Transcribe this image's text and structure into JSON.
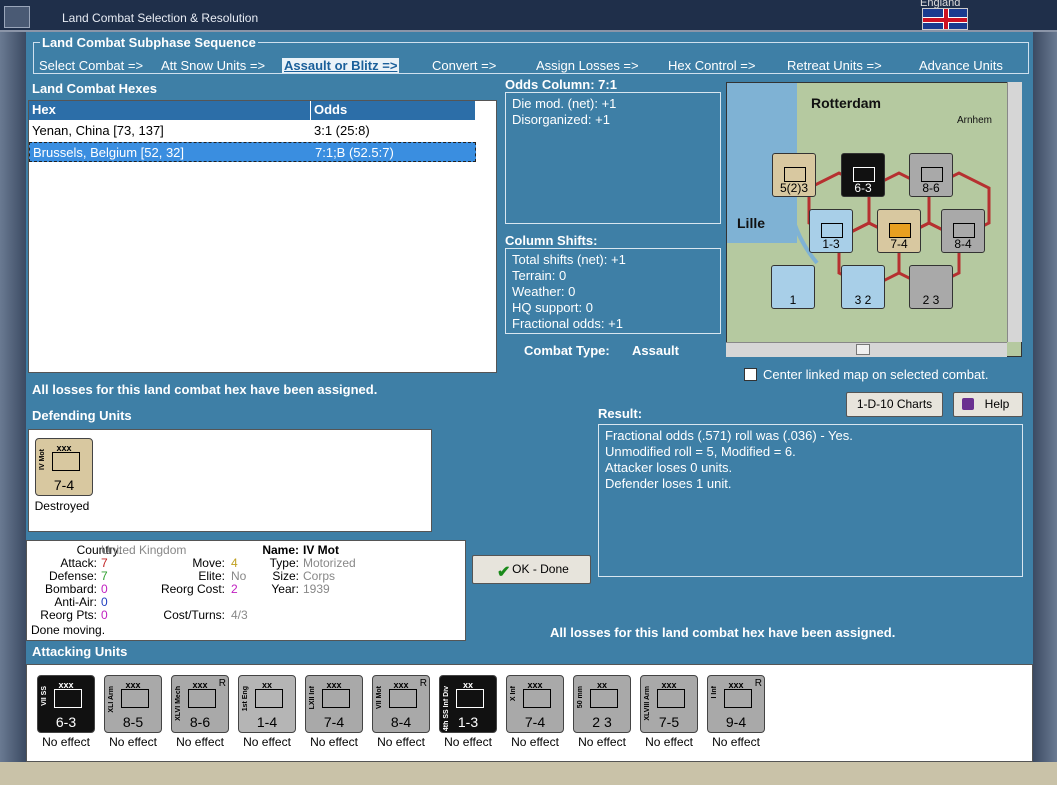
{
  "window": {
    "title": "Land Combat Selection & Resolution",
    "nation": "England"
  },
  "sequence": {
    "title": "Land Combat Subphase Sequence",
    "items": [
      "Select Combat =>",
      "Att Snow Units =>",
      "Assault or Blitz =>",
      "Convert =>",
      "Assign Losses =>",
      "Hex Control =>",
      "Retreat Units =>",
      "Advance Units"
    ],
    "active_index": 2
  },
  "hexes": {
    "title": "Land Combat Hexes",
    "col_hex": "Hex",
    "col_odds": "Odds",
    "rows": [
      {
        "hex": "Yenan, China [73, 137]",
        "odds": "3:1 (25:8)",
        "selected": false
      },
      {
        "hex": "Brussels, Belgium [52, 32]",
        "odds": "7:1;B (52.5:7)",
        "selected": true
      }
    ]
  },
  "odds": {
    "title": "Odds Column: 7:1",
    "lines": [
      "Die mod. (net): +1",
      "Disorganized: +1"
    ]
  },
  "shifts": {
    "title": "Column Shifts:",
    "lines": [
      "Total shifts (net): +1",
      "Terrain: 0",
      "Weather: 0",
      "HQ support: 0",
      "Fractional odds: +1"
    ]
  },
  "combat_type": {
    "label": "Combat Type:",
    "value": "Assault"
  },
  "map": {
    "labels": [
      "Rotterdam",
      "Lille",
      "Arnhem"
    ]
  },
  "losses_msg": "All losses for this land combat hex have been assigned.",
  "center_checkbox": "Center linked map on selected combat.",
  "buttons": {
    "charts": "1-D-10 Charts",
    "help": "Help",
    "ok": "OK - Done"
  },
  "defending": {
    "title": "Defending Units",
    "units": [
      {
        "name": "IV Mot",
        "size": "xxx",
        "strength": "7-4",
        "status": "Destroyed",
        "color": "#d8c8a0"
      }
    ]
  },
  "stats": {
    "country_l": "Country:",
    "country": "United Kingdom",
    "attack_l": "Attack:",
    "attack": "7",
    "defense_l": "Defense:",
    "defense": "7",
    "bombard_l": "Bombard:",
    "bombard": "0",
    "antiair_l": "Anti-Air:",
    "antiair": "0",
    "reorg_l": "Reorg Pts:",
    "reorg": "0",
    "move_l": "Move:",
    "move": "4",
    "elite_l": "Elite:",
    "elite": "No",
    "reorgcost_l": "Reorg Cost:",
    "reorgcost": "2",
    "costturns_l": "Cost/Turns:",
    "costturns": "4/3",
    "name_l": "Name:",
    "name": "IV Mot",
    "type_l": "Type:",
    "type": "Motorized",
    "size_l": "Size:",
    "size": "Corps",
    "year_l": "Year:",
    "year": "1939",
    "done": "Done moving."
  },
  "result": {
    "title": "Result:",
    "lines": [
      "Fractional odds (.571) roll was (.036)  - Yes.",
      "Unmodified roll = 5, Modified = 6.",
      "Attacker loses 0 units.",
      "Defender loses 1 unit."
    ]
  },
  "attacking": {
    "title": "Attacking Units",
    "units": [
      {
        "name": "VII SS",
        "size": "xxx",
        "strength": "6-3",
        "status": "No effect",
        "color": "#111111",
        "fg": "#ffffff",
        "r": ""
      },
      {
        "name": "XLI Arm",
        "size": "xxx",
        "strength": "8-5",
        "status": "No effect",
        "color": "#a9a9a9",
        "fg": "#000000",
        "r": ""
      },
      {
        "name": "XLVI Mech",
        "size": "xxx",
        "strength": "8-6",
        "status": "No effect",
        "color": "#a9a9a9",
        "fg": "#000000",
        "r": "R"
      },
      {
        "name": "1st Eng",
        "size": "xx",
        "strength": "1-4",
        "status": "No effect",
        "color": "#b5b5b5",
        "fg": "#000000",
        "r": ""
      },
      {
        "name": "LXII Inf",
        "size": "xxx",
        "strength": "7-4",
        "status": "No effect",
        "color": "#a9a9a9",
        "fg": "#000000",
        "r": ""
      },
      {
        "name": "VII Mot",
        "size": "xxx",
        "strength": "8-4",
        "status": "No effect",
        "color": "#a9a9a9",
        "fg": "#000000",
        "r": "R"
      },
      {
        "name": "4th SS Inf Div",
        "size": "xx",
        "strength": "1-3",
        "status": "No effect",
        "color": "#111111",
        "fg": "#ffffff",
        "r": ""
      },
      {
        "name": "X Inf",
        "size": "xxx",
        "strength": "7-4",
        "status": "No effect",
        "color": "#a9a9a9",
        "fg": "#000000",
        "r": ""
      },
      {
        "name": "50 mm",
        "size": "xx",
        "strength": "2 3",
        "status": "No effect",
        "color": "#a9a9a9",
        "fg": "#000000",
        "r": ""
      },
      {
        "name": "XLVIII Arm",
        "size": "xxx",
        "strength": "7-5",
        "status": "No effect",
        "color": "#a9a9a9",
        "fg": "#000000",
        "r": ""
      },
      {
        "name": "I Inf",
        "size": "xxx",
        "strength": "9-4",
        "status": "No effect",
        "color": "#a9a9a9",
        "fg": "#000000",
        "r": "R"
      }
    ]
  }
}
